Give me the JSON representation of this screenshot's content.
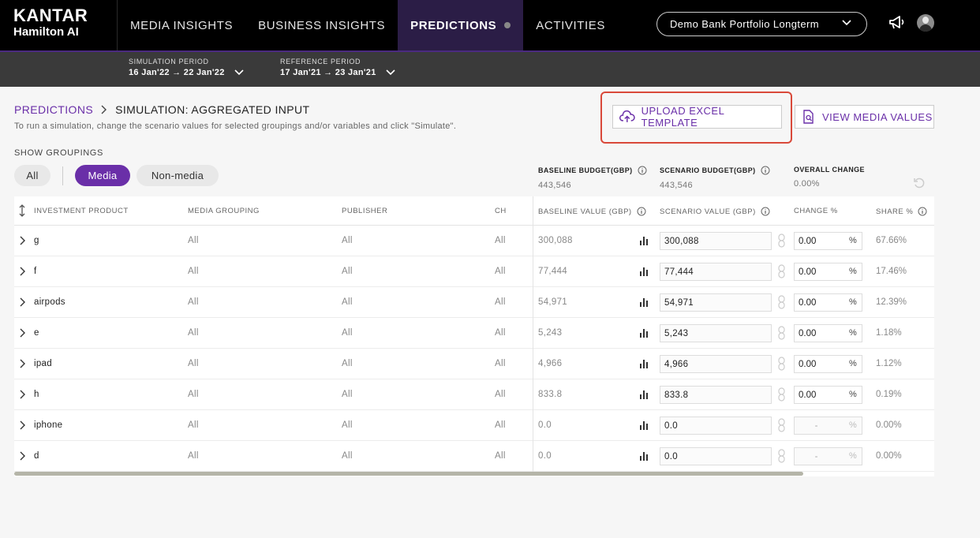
{
  "brand": {
    "name": "KANTAR",
    "product": "Hamilton AI"
  },
  "nav": {
    "items": [
      {
        "label": "MEDIA INSIGHTS"
      },
      {
        "label": "BUSINESS INSIGHTS"
      },
      {
        "label": "PREDICTIONS",
        "active": true
      },
      {
        "label": "ACTIVITIES"
      }
    ]
  },
  "portfolio": {
    "selected": "Demo Bank Portfolio Longterm"
  },
  "periods": {
    "simulation": {
      "label": "SIMULATION PERIOD",
      "value": "16 Jan'22 → 22 Jan'22"
    },
    "reference": {
      "label": "REFERENCE PERIOD",
      "value": "17 Jan'21 → 23 Jan'21"
    }
  },
  "breadcrumb": {
    "parent": "PREDICTIONS",
    "current": "SIMULATION: AGGREGATED INPUT"
  },
  "instructions": "To run a simulation, change the scenario values for selected groupings and/or variables and click \"Simulate\".",
  "actions": {
    "upload": "UPLOAD EXCEL TEMPLATE",
    "view": "VIEW MEDIA VALUES"
  },
  "groupings": {
    "label": "SHOW GROUPINGS",
    "options": [
      "All",
      "Media",
      "Non-media"
    ],
    "selected": "Media"
  },
  "budgets": {
    "baseline": {
      "label": "BASELINE BUDGET(GBP)",
      "value": "443,546"
    },
    "scenario": {
      "label": "SCENARIO BUDGET(GBP)",
      "value": "443,546"
    },
    "overall": {
      "label": "OVERALL CHANGE",
      "value": "0.00%"
    }
  },
  "table": {
    "headers": {
      "product": "INVESTMENT PRODUCT",
      "media_grouping": "MEDIA GROUPING",
      "publisher": "PUBLISHER",
      "ch": "CH",
      "baseline": "BASELINE VALUE (GBP)",
      "scenario": "SCENARIO VALUE (GBP)",
      "change": "CHANGE %",
      "share": "SHARE %"
    },
    "rows": [
      {
        "product": "g",
        "media_grouping": "All",
        "publisher": "All",
        "ch": "All",
        "baseline": "300,088",
        "scenario": "300,088",
        "change": "0.00",
        "pct": "%",
        "share": "67.66%"
      },
      {
        "product": "f",
        "media_grouping": "All",
        "publisher": "All",
        "ch": "All",
        "baseline": "77,444",
        "scenario": "77,444",
        "change": "0.00",
        "pct": "%",
        "share": "17.46%"
      },
      {
        "product": "airpods",
        "media_grouping": "All",
        "publisher": "All",
        "ch": "All",
        "baseline": "54,971",
        "scenario": "54,971",
        "change": "0.00",
        "pct": "%",
        "share": "12.39%"
      },
      {
        "product": "e",
        "media_grouping": "All",
        "publisher": "All",
        "ch": "All",
        "baseline": "5,243",
        "scenario": "5,243",
        "change": "0.00",
        "pct": "%",
        "share": "1.18%"
      },
      {
        "product": "ipad",
        "media_grouping": "All",
        "publisher": "All",
        "ch": "All",
        "baseline": "4,966",
        "scenario": "4,966",
        "change": "0.00",
        "pct": "%",
        "share": "1.12%"
      },
      {
        "product": "h",
        "media_grouping": "All",
        "publisher": "All",
        "ch": "All",
        "baseline": "833.8",
        "scenario": "833.8",
        "change": "0.00",
        "pct": "%",
        "share": "0.19%"
      },
      {
        "product": "iphone",
        "media_grouping": "All",
        "publisher": "All",
        "ch": "All",
        "baseline": "0.0",
        "scenario": "0.0",
        "change": "-",
        "pct": "%",
        "share": "0.00%",
        "disabled": true
      },
      {
        "product": "d",
        "media_grouping": "All",
        "publisher": "All",
        "ch": "All",
        "baseline": "0.0",
        "scenario": "0.0",
        "change": "-",
        "pct": "%",
        "share": "0.00%",
        "disabled": true
      }
    ]
  },
  "colors": {
    "accent": "#6a2fa8",
    "highlight": "#d9493a",
    "topbar": "#000000",
    "active_nav": "#2b1d46"
  },
  "icons": [
    "megaphone-icon",
    "avatar",
    "chevron-down-icon",
    "upload-cloud-icon",
    "document-search-icon",
    "info-icon",
    "reset-icon",
    "expand-chevron-icon",
    "bar-chart-icon",
    "link-icon",
    "sort-icon"
  ]
}
